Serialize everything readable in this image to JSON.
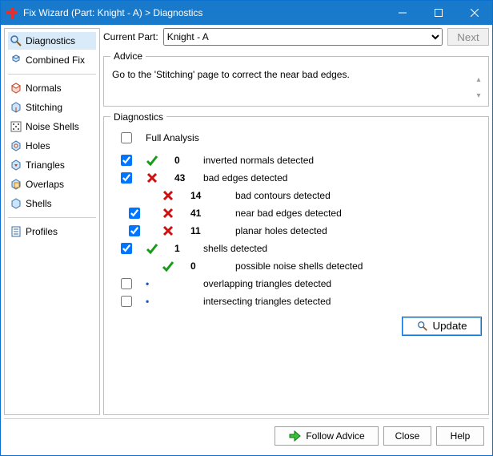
{
  "window_title": "Fix Wizard (Part: Knight - A) > Diagnostics",
  "top": {
    "current_part_label": "Current Part:",
    "current_part_value": "Knight - A",
    "next_button": "Next"
  },
  "sidebar": {
    "diagnostics": "Diagnostics",
    "combined_fix": "Combined Fix",
    "normals": "Normals",
    "stitching": "Stitching",
    "noise_shells": "Noise Shells",
    "holes": "Holes",
    "triangles": "Triangles",
    "overlaps": "Overlaps",
    "shells": "Shells",
    "profiles": "Profiles"
  },
  "advice": {
    "legend": "Advice",
    "text": "Go to the 'Stitching' page to correct the near bad edges."
  },
  "diagnostics": {
    "legend": "Diagnostics",
    "full_analysis_label": "Full Analysis",
    "update_button": "Update",
    "rows": {
      "inverted_normals": {
        "count": "0",
        "label": "inverted normals detected"
      },
      "bad_edges": {
        "count": "43",
        "label": "bad edges detected"
      },
      "bad_contours": {
        "count": "14",
        "label": "bad contours detected"
      },
      "near_bad_edges": {
        "count": "41",
        "label": "near bad edges detected"
      },
      "planar_holes": {
        "count": "11",
        "label": "planar holes detected"
      },
      "shells": {
        "count": "1",
        "label": "shells detected"
      },
      "noise_shells": {
        "count": "0",
        "label": "possible noise shells detected"
      },
      "overlapping": {
        "count": "",
        "label": "overlapping triangles detected"
      },
      "intersecting": {
        "count": "",
        "label": "intersecting triangles detected"
      }
    }
  },
  "footer": {
    "follow_advice": "Follow Advice",
    "close": "Close",
    "help": "Help"
  }
}
